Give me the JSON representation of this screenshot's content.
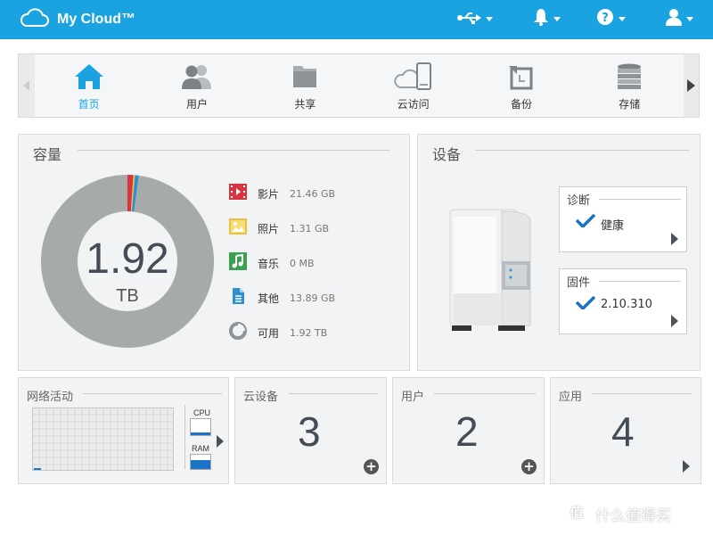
{
  "app": {
    "title": "My Cloud™"
  },
  "colors": {
    "topbar": "#1aa3e0",
    "accent": "#1aa3e0",
    "movies": "#d9343f",
    "photos": "#e7c23a",
    "music": "#3aa24e",
    "other": "#2f8fd0",
    "free": "#a6aaa9"
  },
  "nav": {
    "items": [
      {
        "label": "首页",
        "icon": "home-icon",
        "active": true
      },
      {
        "label": "用户",
        "icon": "users-icon"
      },
      {
        "label": "共享",
        "icon": "folder-icon"
      },
      {
        "label": "云访问",
        "icon": "cloud-access-icon"
      },
      {
        "label": "备份",
        "icon": "backup-icon"
      },
      {
        "label": "存储",
        "icon": "storage-icon"
      }
    ]
  },
  "capacity": {
    "title": "容量",
    "total_value": "1.92",
    "total_unit": "TB",
    "legend": [
      {
        "name": "影片",
        "value": "21.46 GB",
        "icon": "movie-icon"
      },
      {
        "name": "照片",
        "value": "1.31 GB",
        "icon": "photo-icon"
      },
      {
        "name": "音乐",
        "value": "0 MB",
        "icon": "music-icon"
      },
      {
        "name": "其他",
        "value": "13.89 GB",
        "icon": "document-icon"
      },
      {
        "name": "可用",
        "value": "1.92 TB",
        "icon": "pie-icon"
      }
    ]
  },
  "device": {
    "title": "设备",
    "diagnostics": {
      "title": "诊断",
      "value": "健康"
    },
    "firmware": {
      "title": "固件",
      "value": "2.10.310"
    }
  },
  "network": {
    "title": "网络活动",
    "cpu_label": "CPU",
    "ram_label": "RAM"
  },
  "cloud_devices": {
    "title": "云设备",
    "count": "3"
  },
  "users": {
    "title": "用户",
    "count": "2"
  },
  "apps": {
    "title": "应用",
    "count": "4"
  },
  "watermark": {
    "text": "什么值得买"
  },
  "chart_data": {
    "type": "pie",
    "categories": [
      "影片",
      "照片",
      "音乐",
      "其他",
      "可用"
    ],
    "values": [
      21.46,
      1.31,
      0,
      13.89,
      1920
    ],
    "unit": "GB",
    "donut": true
  }
}
